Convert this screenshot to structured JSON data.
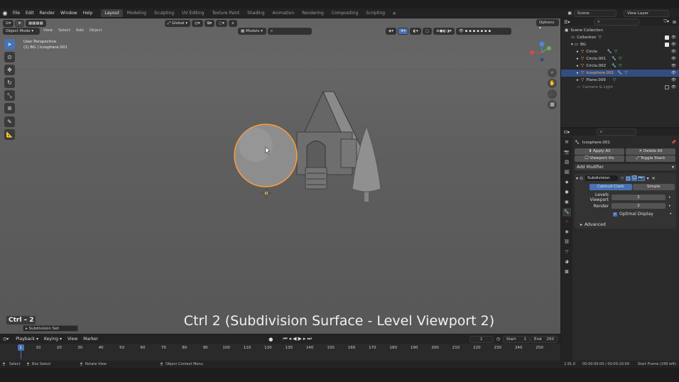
{
  "topbar": {
    "menus": [
      "File",
      "Edit",
      "Render",
      "Window",
      "Help"
    ],
    "workspaces": [
      "Layout",
      "Modeling",
      "Sculpting",
      "UV Editing",
      "Texture Paint",
      "Shading",
      "Animation",
      "Rendering",
      "Compositing",
      "Scripting"
    ],
    "active_workspace": "Layout",
    "add_symbol": "+",
    "scene_name": "Scene",
    "view_layer": "View Layer"
  },
  "viewport": {
    "mode": "Object Mode",
    "menus": [
      "View",
      "Select",
      "Add",
      "Object"
    ],
    "transform_orientation": "Global",
    "models_label": "Models",
    "options_label": "Options",
    "info_line1": "User Perspective",
    "info_line2": "(1) BG | Icosphere.001",
    "gizmo_axes": {
      "x": "X",
      "y": "Y",
      "z": "Z"
    },
    "caption": "Ctrl 2 (Subdivision Surface - Level Viewport 2)",
    "shortcut_badge": "Ctrl – 2",
    "last_op": "Subdivision Set"
  },
  "outliner": {
    "rows": [
      {
        "label": "Scene Collection",
        "indent": 0
      },
      {
        "label": "Collection",
        "indent": 1
      },
      {
        "label": "BG",
        "indent": 1
      },
      {
        "label": "Circle",
        "indent": 2
      },
      {
        "label": "Circle.001",
        "indent": 2
      },
      {
        "label": "Circle.002",
        "indent": 2
      },
      {
        "label": "Icosphere.001",
        "indent": 2,
        "selected": true
      },
      {
        "label": "Plane.009",
        "indent": 2
      },
      {
        "label": "Camera & Light",
        "indent": 1
      }
    ]
  },
  "properties": {
    "object_name": "Icosphere.001",
    "apply_all": "Apply All",
    "delete_all": "Delete All",
    "viewport_vis": "Viewport Vis",
    "toggle_stack": "Toggle Stack",
    "add_modifier": "Add Modifier",
    "modifier_name": "Subdivision",
    "catmull": "Catmull-Clark",
    "simple": "Simple",
    "levels_viewport_label": "Levels Viewport",
    "levels_viewport_value": "2",
    "render_label": "Render",
    "render_value": "2",
    "optimal_display": "Optimal Display",
    "advanced": "Advanced"
  },
  "timeline": {
    "menus": [
      "Playback",
      "Keying",
      "View",
      "Marker"
    ],
    "current_frame": "1",
    "start_label": "Start",
    "start_value": "1",
    "end_label": "End",
    "end_value": "250",
    "ticks": [
      "1",
      "10",
      "20",
      "30",
      "40",
      "50",
      "60",
      "70",
      "80",
      "90",
      "100",
      "110",
      "120",
      "130",
      "140",
      "150",
      "160",
      "170",
      "180",
      "190",
      "200",
      "210",
      "220",
      "230",
      "240",
      "250"
    ]
  },
  "statusbar": {
    "select": "Select",
    "box_select": "Box Select",
    "rotate_view": "Rotate View",
    "context_menu": "Object Context Menu",
    "version": "2.91.0",
    "time": "00:00:00:00 / 00:00:10:09",
    "start_frame": "Start Frame (249 left)"
  },
  "colors": {
    "accent": "#4772b3",
    "selection": "#ff9b3a",
    "header": "#232323"
  }
}
